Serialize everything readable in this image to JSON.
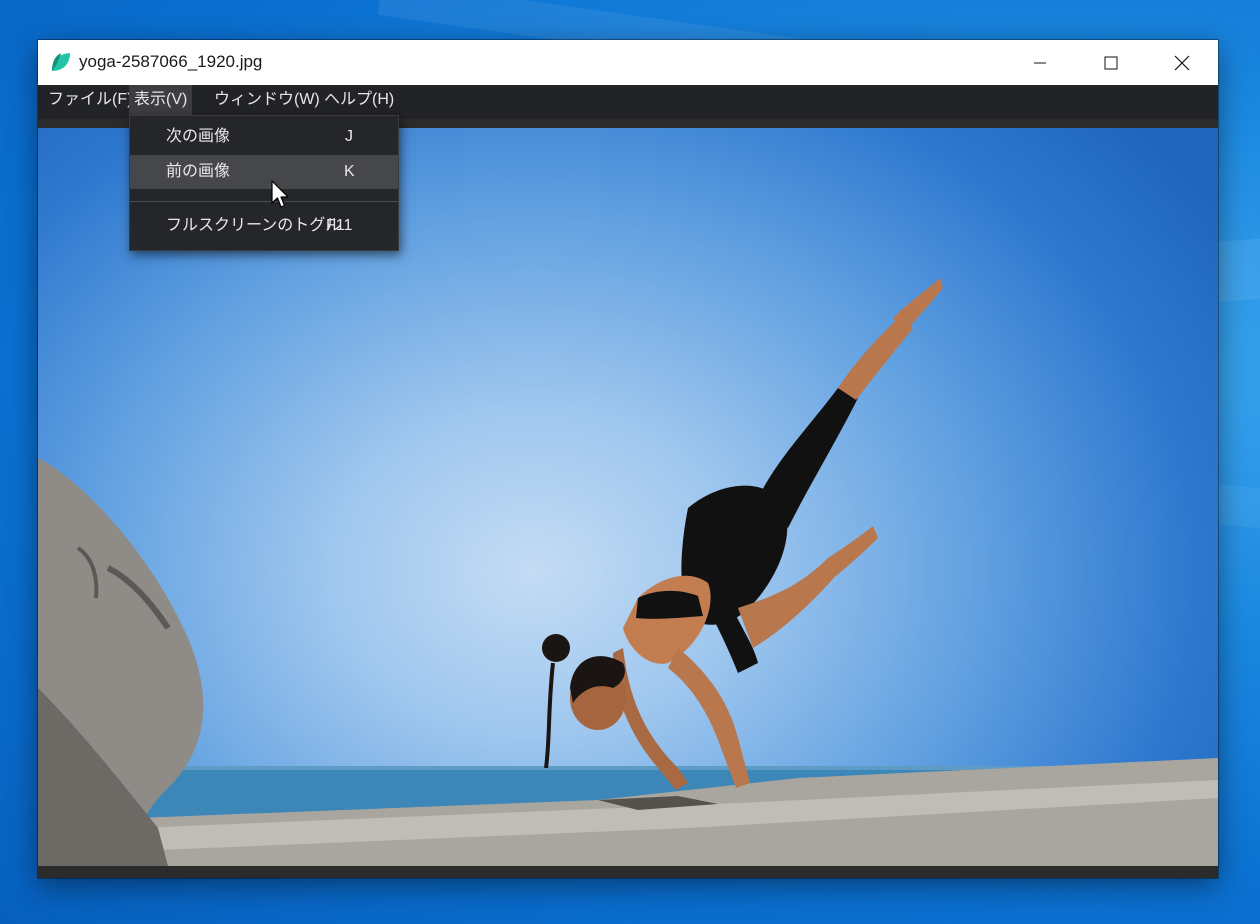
{
  "window": {
    "title": "yoga-2587066_1920.jpg",
    "icon": "leaf-icon",
    "controls": [
      "minimize-icon",
      "maximize-icon",
      "close-icon"
    ]
  },
  "menubar": {
    "items": [
      {
        "label": "ファイル(F)"
      },
      {
        "label": "表示(V)"
      },
      {
        "label": "ウィンドウ(W)"
      },
      {
        "label": "ヘルプ(H)"
      }
    ],
    "active_index": 1
  },
  "view_menu": {
    "items": [
      {
        "label": "次の画像",
        "shortcut": "J"
      },
      {
        "label": "前の画像",
        "shortcut": "K"
      },
      {
        "label": "フルスクリーンのトグル",
        "shortcut": "F11"
      }
    ],
    "hovered_index": 1
  },
  "colors": {
    "accent": "#1fb89a",
    "menubar": "#222326",
    "menu_hover": "#46474b"
  }
}
